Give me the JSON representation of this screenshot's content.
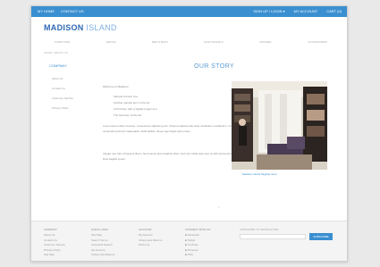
{
  "topbar": {
    "home": "MY HOME",
    "contact": "CONTACT US",
    "signup": "SIGN UP / LOGIN ▾",
    "account": "MY ACCOUNT",
    "cart": "CART (0)"
  },
  "brand": {
    "name_bold": "MADISON",
    "name_light": "ISLAND"
  },
  "nav": [
    "FURNITURE",
    "DECOR",
    "BED & BATH",
    "ELECTRONICS",
    "APPAREL",
    "ACCESSORIES"
  ],
  "breadcrumb": "HOME / ABOUT US",
  "sidebar": {
    "title": "COMPANY",
    "items": [
      "About Us",
      "Contact Us",
      "Customer Service",
      "Privacy Policy"
    ]
  },
  "page": {
    "title": "OUR STORY",
    "lead": "Welcome to Madison!",
    "list": [
      "Sample list item one",
      "Another sample item in the list",
      "A third item with a slightly longer text",
      "The final item of the list"
    ],
    "paragraphs": [
      "Lorem ipsum dolor sit amet, consectetur adipiscing elit. Vivamus lacinia odio vitae vestibulum vestibulum. Cras venenatis euismod malesuada. Nulla facilisi, donec eget ligula quis metus.",
      "Integer nec odio. Praesent libero. Sed cursus ante dapibus diam. Sed nisi. Nulla quis sem at nibh elementum imperdiet. Duis sagittis ipsum."
    ],
    "photo_caption": "Madison Island flagship store",
    "pager": "1"
  },
  "footer": {
    "columns": [
      {
        "title": "COMPANY",
        "items": [
          "About Us",
          "Contact Us",
          "Customer Service",
          "Privacy Policy",
          "Site Map"
        ]
      },
      {
        "title": "QUICK LINKS",
        "items": [
          "Site Map",
          "Search Terms",
          "Advanced Search",
          "My Account",
          "Orders and Returns"
        ]
      },
      {
        "title": "ACCOUNT",
        "items": [
          "My Account",
          "Orders and Returns",
          "Wish List"
        ]
      },
      {
        "title": "CONNECT WITH US",
        "items": [
          "Facebook",
          "Twitter",
          "YouTube",
          "Pinterest",
          "RSS"
        ]
      }
    ],
    "newsletter": {
      "label": "SUBSCRIBE TO NEWSLETTER",
      "placeholder": "",
      "button": "SUBSCRIBE"
    }
  },
  "colors": {
    "accent": "#3a8fd0"
  }
}
